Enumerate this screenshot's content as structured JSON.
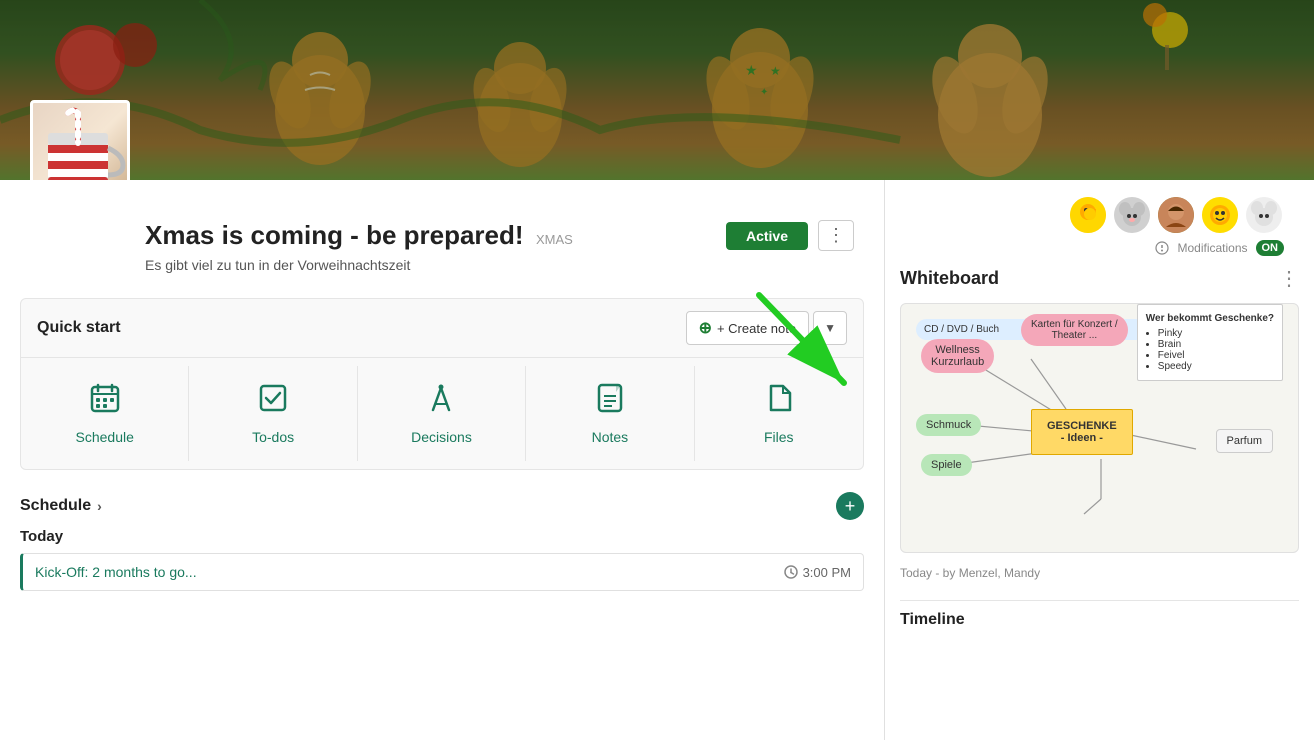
{
  "banner": {
    "alt": "Christmas banner with gingerbread cookies"
  },
  "title": {
    "main": "Xmas is coming - be prepared!",
    "tag": "XMAS",
    "subtitle": "Es gibt viel zu tun in der Vorweihnachtszeit"
  },
  "status": {
    "badge": "Active"
  },
  "avatars": [
    "🐦",
    "🐭",
    "👩",
    "⭐",
    "🐭"
  ],
  "modifications": {
    "label": "Modifications",
    "toggle": "ON"
  },
  "quickStart": {
    "title": "Quick start",
    "createNoteBtn": "+ Create note",
    "dropdownLabel": "▼",
    "actions": [
      {
        "id": "schedule",
        "icon": "📅",
        "label": "Schedule"
      },
      {
        "id": "todos",
        "icon": "☑",
        "label": "To-dos"
      },
      {
        "id": "decisions",
        "icon": "🔨",
        "label": "Decisions"
      },
      {
        "id": "notes",
        "icon": "📋",
        "label": "Notes"
      },
      {
        "id": "files",
        "icon": "📄",
        "label": "Files"
      }
    ]
  },
  "schedule": {
    "title": "Schedule",
    "chevron": "›",
    "addBtn": "+"
  },
  "today": {
    "label": "Today",
    "events": [
      {
        "title": "Kick-Off: 2 months to go...",
        "time": "3:00 PM"
      }
    ]
  },
  "whiteboard": {
    "title": "Whiteboard",
    "moreBtn": "⋮",
    "footer": "Today - by Menzel, Mandy",
    "nodes": {
      "wellness": "Wellness\nKurzurlaub",
      "karten": "Karten für Konzert /\nTheater ...",
      "wer": {
        "title": "Wer bekommt Geschenke?",
        "items": [
          "Pinky",
          "Brain",
          "Feivel",
          "Speedy"
        ]
      },
      "schmuck": "Schmuck",
      "spiele": "Spiele",
      "geschenke": "GESCHENKE\n- Ideen -",
      "parfum": "Parfum",
      "cd": "CD / DVD / Buch"
    }
  },
  "bottomSection": {
    "title": "Timeline"
  }
}
